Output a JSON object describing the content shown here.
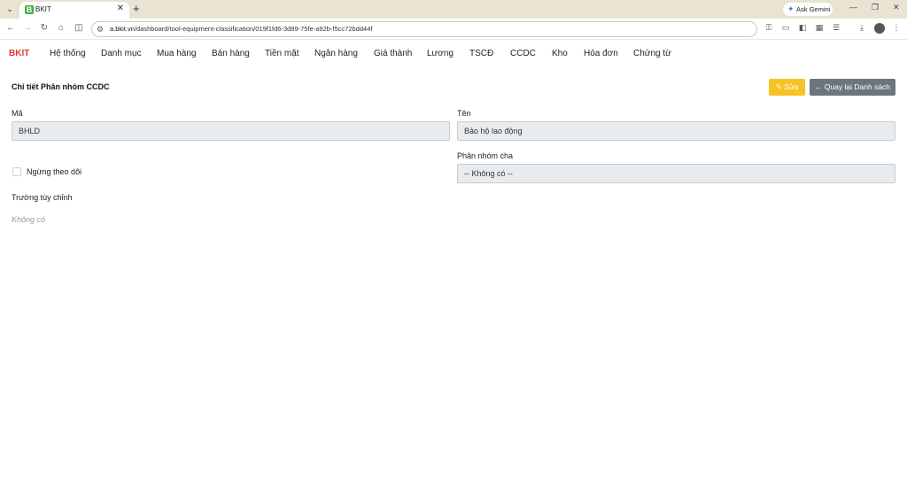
{
  "browser": {
    "tab_title": "BKIT",
    "favicon_letter": "B",
    "url_host": "a.bkit.vn",
    "url_path": "/dashboard/tool-equipment-classification/019f1fd6-3d89-75fe-a92b-f5cc72bdd44f",
    "ask_gemini": "Ask Gemini",
    "icons": [
      "tab-list-icon",
      "close-icon",
      "new-tab-icon",
      "back-icon",
      "forward-icon",
      "reload-icon",
      "home-icon",
      "sidebar-icon",
      "site-info-icon",
      "password-key-icon",
      "card-icon",
      "split-view-icon",
      "extensions-icon",
      "bookmarks-icon",
      "download-icon",
      "profile-icon",
      "menu-icon"
    ]
  },
  "nav": {
    "brand": "BKIT",
    "brand_color": "#e53935",
    "items": [
      "Hệ thống",
      "Danh mục",
      "Mua hàng",
      "Bán hàng",
      "Tiền mặt",
      "Ngân hàng",
      "Giá thành",
      "Lương",
      "TSCĐ",
      "CCDC",
      "Kho",
      "Hóa đơn",
      "Chứng từ"
    ]
  },
  "page": {
    "title": "Chi tiết Phân nhóm CCDC",
    "edit_label": "Sửa",
    "back_label": "Quay lại Danh sách",
    "edit_color": "#f6c324",
    "back_color": "#6c757d"
  },
  "form": {
    "code_label": "Mã",
    "code_value": "BHLD",
    "name_label": "Tên",
    "name_value": "Bảo hộ lao động",
    "inactive_label": "Ngừng theo dõi",
    "inactive_checked": false,
    "parent_label": "Phân nhóm cha",
    "parent_value": "-- Không có --",
    "custom_fields_label": "Trường tùy chỉnh",
    "custom_fields_empty": "Không có"
  }
}
